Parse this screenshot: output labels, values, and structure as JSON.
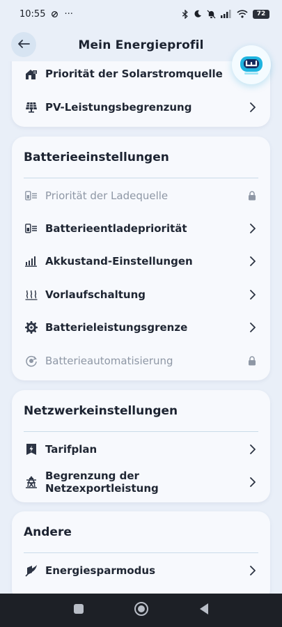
{
  "status_bar": {
    "time": "10:55",
    "dots": "···",
    "battery": "72"
  },
  "header": {
    "title": "Mein Energieprofil"
  },
  "cards": {
    "top": {
      "items": [
        {
          "label": "Priorität der Solarstromquelle",
          "icon": "house-solar-icon",
          "trailing": "none"
        },
        {
          "label": "PV-Leistungsbegrenzung",
          "icon": "solar-panel-icon",
          "trailing": "chevron"
        }
      ]
    },
    "battery": {
      "title": "Batterieeinstellungen",
      "items": [
        {
          "label": "Priorität der Ladequelle",
          "icon": "battery-list-icon",
          "trailing": "lock",
          "disabled": true
        },
        {
          "label": "Batterieentladepriorität",
          "icon": "battery-list-icon",
          "trailing": "chevron"
        },
        {
          "label": "Akkustand-Einstellungen",
          "icon": "bars-level-icon",
          "trailing": "chevron"
        },
        {
          "label": "Vorlaufschaltung",
          "icon": "heat-waves-icon",
          "trailing": "chevron"
        },
        {
          "label": "Batterieleistungsgrenze",
          "icon": "gear-icon",
          "trailing": "chevron"
        },
        {
          "label": "Batterieautomatisierung",
          "icon": "auto-cycle-icon",
          "trailing": "lock",
          "disabled": true
        }
      ]
    },
    "network": {
      "title": "Netzwerkeinstellungen",
      "items": [
        {
          "label": "Tarifplan",
          "icon": "tariff-bolt-icon",
          "trailing": "chevron"
        },
        {
          "label": "Begrenzung der Netzexportleistung",
          "icon": "grid-tower-icon",
          "trailing": "chevron"
        }
      ]
    },
    "other": {
      "title": "Andere",
      "items": [
        {
          "label": "Energiesparmodus",
          "icon": "eco-leaf-icon",
          "trailing": "chevron"
        }
      ]
    }
  }
}
